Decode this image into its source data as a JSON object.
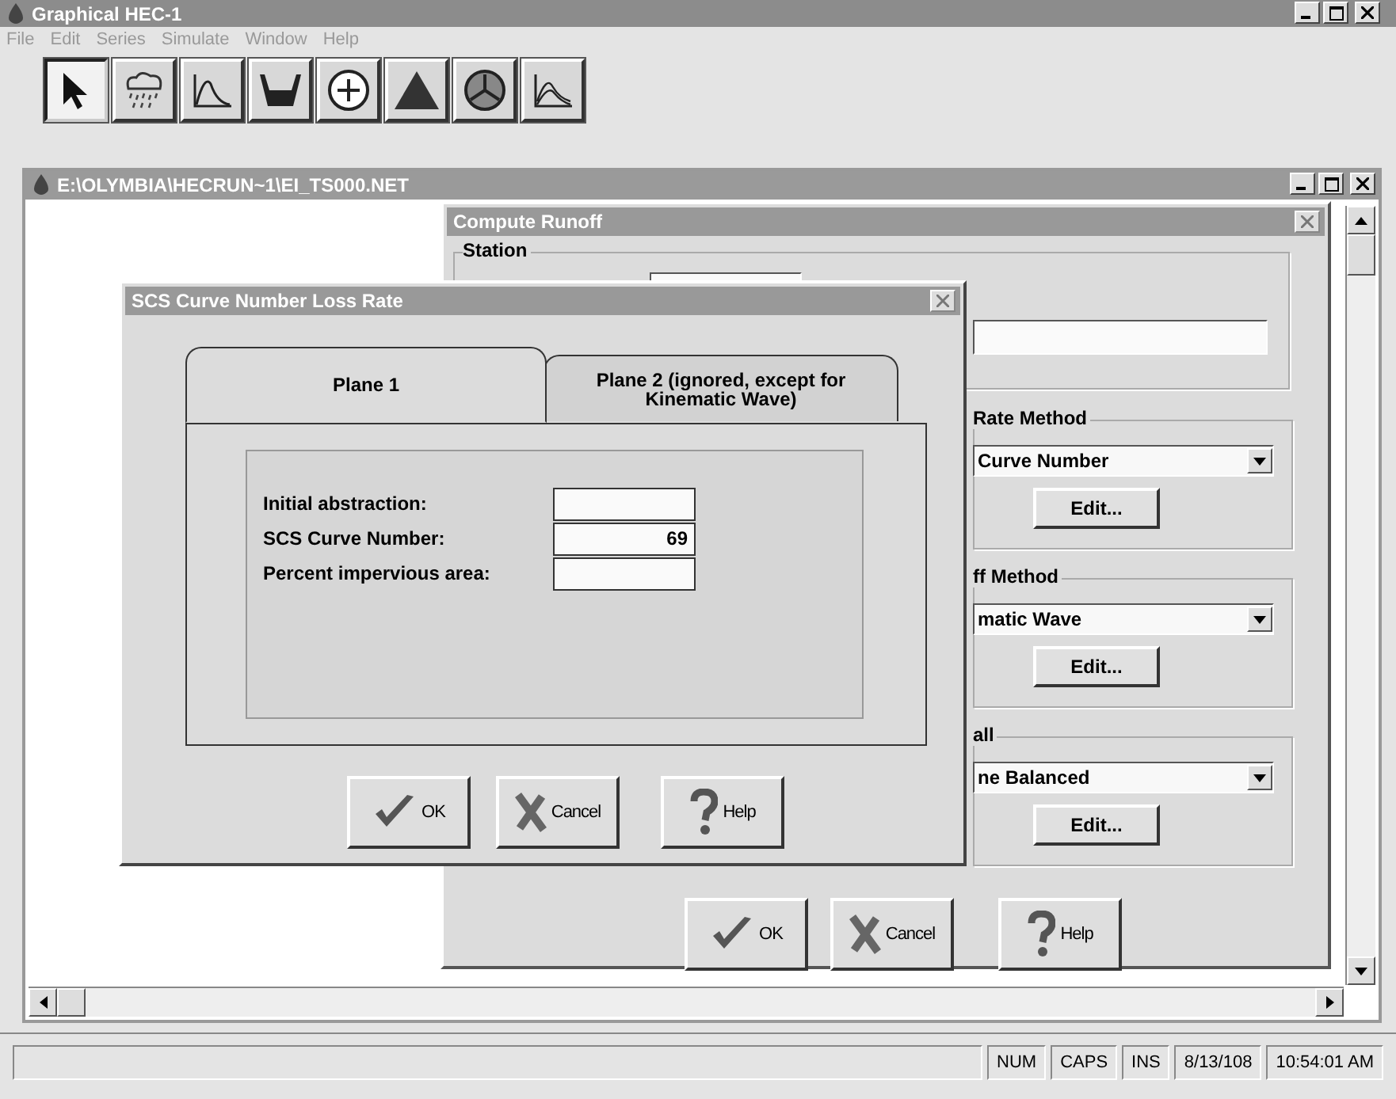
{
  "app_window": {
    "title": "Graphical HEC-1",
    "menu": [
      "File",
      "Edit",
      "Series",
      "Simulate",
      "Window",
      "Help"
    ],
    "toolbar": [
      {
        "kind": "pointer",
        "selected": true
      },
      {
        "kind": "cloud",
        "selected": false
      },
      {
        "kind": "hydrograph",
        "selected": false
      },
      {
        "kind": "basin",
        "selected": false
      },
      {
        "kind": "junction",
        "selected": false
      },
      {
        "kind": "triangle",
        "selected": false
      },
      {
        "kind": "wheel",
        "selected": false
      },
      {
        "kind": "graph",
        "selected": false
      }
    ]
  },
  "document_window": {
    "title": "E:\\OLYMBIA\\HECRUN~1\\EI_TS000.NET"
  },
  "compute_runoff": {
    "title": "Compute Runoff",
    "station_label": "Station",
    "groups": [
      {
        "label": "Rate Method",
        "selection": "Curve Number",
        "edit_button": "Edit..."
      },
      {
        "label": "ff Method",
        "selection": "matic Wave",
        "edit_button": "Edit..."
      },
      {
        "label": "all",
        "selection": "ne Balanced",
        "edit_button": "Edit..."
      }
    ],
    "buttons": [
      {
        "kind": "ok",
        "label": "OK"
      },
      {
        "kind": "cancel",
        "label": "Cancel"
      },
      {
        "kind": "help",
        "label": "Help"
      }
    ]
  },
  "loss_rate_dialog": {
    "title": "SCS Curve Number Loss Rate",
    "tabs": [
      {
        "label": "Plane 1",
        "selected": true
      },
      {
        "label": "Plane 2 (ignored, except for Kinematic Wave)",
        "selected": false
      }
    ],
    "fields": [
      {
        "label": "Initial abstraction:"
      },
      {
        "label": "SCS Curve Number:",
        "value": "69"
      },
      {
        "label": "Percent impervious area:"
      }
    ],
    "buttons": [
      {
        "kind": "ok",
        "label": "OK"
      },
      {
        "kind": "cancel",
        "label": "Cancel"
      },
      {
        "kind": "help",
        "label": "Help"
      }
    ]
  },
  "status_bar": {
    "panes": [
      "NUM",
      "CAPS",
      "INS",
      "8/13/108",
      "10:54:01 AM"
    ]
  }
}
